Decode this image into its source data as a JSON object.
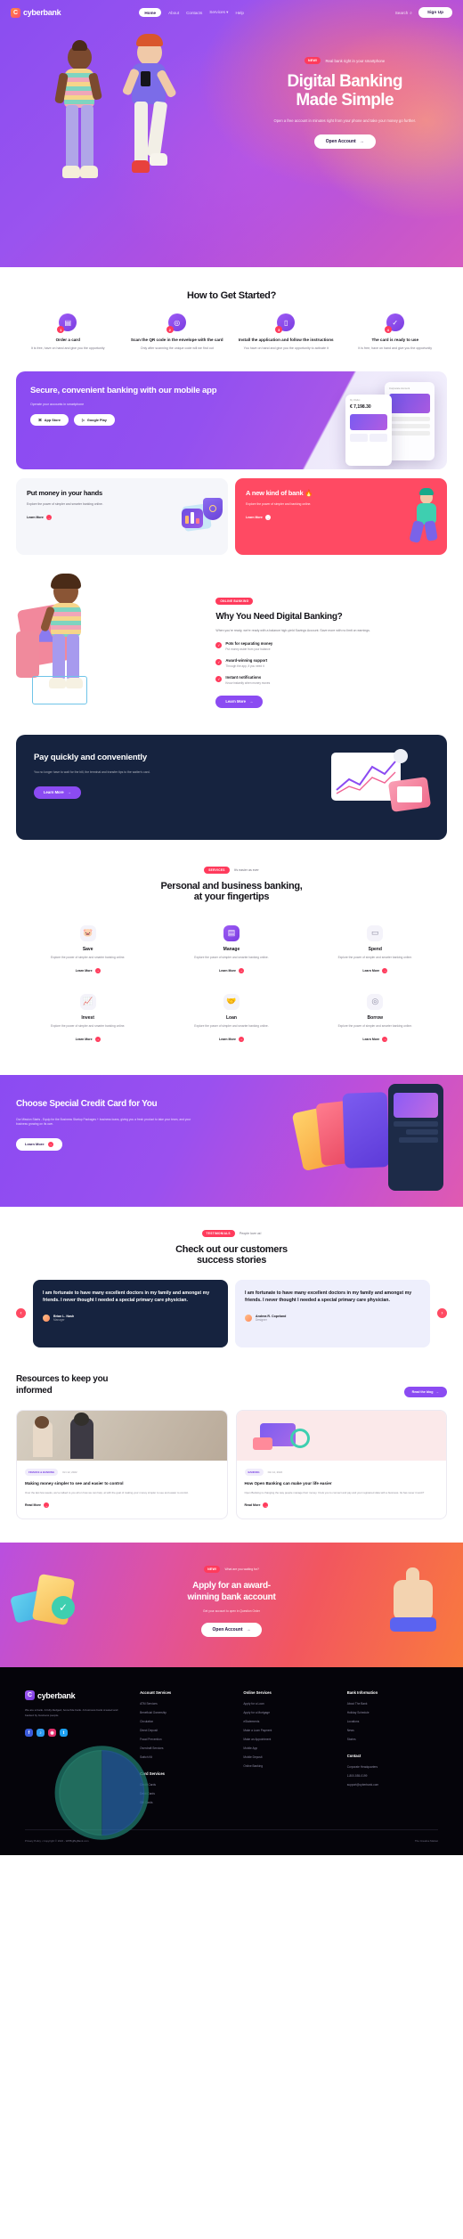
{
  "brand": {
    "name": "cyberbank",
    "mark": "C"
  },
  "nav": {
    "links": [
      {
        "label": "Home",
        "active": true
      },
      {
        "label": "About",
        "active": false
      },
      {
        "label": "Contacts",
        "active": false
      },
      {
        "label": "Services",
        "active": false
      },
      {
        "label": "Help",
        "active": false
      }
    ],
    "search_label": "Search",
    "search_icon": "search-icon",
    "signup_label": "Sign Up"
  },
  "hero": {
    "badge": "NEW!",
    "badge_text": "Real bank right in your smartphone",
    "title_line1": "Digital Banking",
    "title_line2": "Made Simple",
    "subtitle": "Open a free account in minutes right from your phone and take your money go further.",
    "cta_label": "Open Account",
    "cta_icon": "arrow-right-icon"
  },
  "steps_section": {
    "title": "How to Get Started?",
    "steps": [
      {
        "num": "1",
        "icon": "credit-card-icon",
        "title": "Order a card",
        "desc": "It is free, have on hand and give you the opportunity"
      },
      {
        "num": "2",
        "icon": "qr-scan-icon",
        "title": "Scan the QR code in the envelope with the card",
        "desc": "Only after scanning the unique code will we find out"
      },
      {
        "num": "3",
        "icon": "mobile-app-icon",
        "title": "Install the application and follow the instructions",
        "desc": "You have on hand and give you the opportunity to activate it"
      },
      {
        "num": "4",
        "icon": "check-circle-icon",
        "title": "The card is ready to use",
        "desc": "It is free, have on hand and give you the opportunity"
      }
    ]
  },
  "app_card": {
    "title": "Secure, convenient banking with our mobile app",
    "subtitle": "Operate your accounts in smartphone",
    "stores": [
      {
        "label": "App Store",
        "icon": "apple-icon"
      },
      {
        "label": "Google Play",
        "icon": "play-icon"
      }
    ],
    "mock_balance": "€ 7,198.30",
    "mock_label": "My Wallet",
    "mock_card_label": "Corporate Account"
  },
  "duo": [
    {
      "id": "put-money",
      "title": "Put money in your hands",
      "desc": "Explore the power of simpler and smarter banking online.",
      "learn_label": "Learn More",
      "theme": "light"
    },
    {
      "id": "new-bank",
      "title": "A new kind of bank 🔥",
      "desc": "Explore the power of simpler and banking online.",
      "learn_label": "Learn More",
      "theme": "red"
    }
  ],
  "why": {
    "tag": "ONLINE BANKING",
    "title": "Why You Need Digital Banking?",
    "lede": "When you're ready, we're ready with a balance high-yield Savings Account. Save more with no limit on earnings.",
    "features": [
      {
        "title": "Pots for separating money",
        "desc": "Put money aside from your balance"
      },
      {
        "title": "Award-winning support",
        "desc": "Through the app, if you need it"
      },
      {
        "title": "Instant notifications",
        "desc": "Know instantly when money moves"
      }
    ],
    "cta_label": "Learn More"
  },
  "pay_card": {
    "title": "Pay quickly and conveniently",
    "desc": "You no longer have to wait for the bill, the terminal and transfer tips to the waiter's card.",
    "cta_label": "Learn More"
  },
  "services": {
    "tag": "SERVICES",
    "tag_text": "It's easier as ever",
    "title_line1": "Personal and business banking,",
    "title_line2": "at your fingertips",
    "items": [
      {
        "icon": "piggy-bank-icon",
        "title": "Save",
        "desc": "Explore the power of simpler and smarter banking online.",
        "learn": "Learn More"
      },
      {
        "icon": "calculator-icon",
        "title": "Manage",
        "desc": "Explore the power of simpler and smarter banking online.",
        "learn": "Learn More"
      },
      {
        "icon": "wallet-icon",
        "title": "Spend",
        "desc": "Explore the power of simpler and smarter banking online.",
        "learn": "Learn More"
      },
      {
        "icon": "chart-up-icon",
        "title": "Invest",
        "desc": "Explore the power of simpler and smarter banking online.",
        "learn": "Learn More"
      },
      {
        "icon": "handshake-icon",
        "title": "Loan",
        "desc": "Explore the power of simpler and smarter banking online.",
        "learn": "Learn More"
      },
      {
        "icon": "coins-icon",
        "title": "Borrow",
        "desc": "Explore the power of simpler and smarter banking online.",
        "learn": "Learn More"
      }
    ]
  },
  "credit_card": {
    "title": "Choose Special Credit Card for You",
    "desc": "Our Mission Starts - Equip for the Business Startup Packages + business loans, giving you a fresh product to take your team, and your business growing on its own.",
    "cta_label": "Learn More"
  },
  "testimonials": {
    "tag": "TESTIMONIALS",
    "tag_text": "People love us!",
    "title_line1": "Check out our customers",
    "title_line2": "success stories",
    "prev_icon": "chevron-left-icon",
    "next_icon": "chevron-right-icon",
    "items": [
      {
        "quote": "I am fortunate to have many excellent doctors in my family and amongst my friends. I never thought I needed a special primary care physician.",
        "name": "Brian L. Nash",
        "role": "Manager",
        "theme": "dark"
      },
      {
        "quote": "I am fortunate to have many excellent doctors in my family and amongst my friends. I never thought I needed a special primary care physician.",
        "name": "Andrea R. Copeland",
        "role": "Designer",
        "theme": "light"
      }
    ]
  },
  "resources": {
    "title_line1": "Resources to keep you",
    "title_line2": "informed",
    "cta_label": "Read the blog",
    "posts": [
      {
        "category": "FINANCE & BANKING",
        "date": "Oct 12, 2022",
        "title": "Making money simpler to see and easier to control",
        "desc": "Over the last few weeks, we've talked to you all on how we can help, at with the goal of making your money simpler to see and easier to control.",
        "learn": "Read More"
      },
      {
        "category": "BANKING",
        "date": "Oct 12, 2022",
        "title": "How Open Banking can make your life easier",
        "desc": "Open Banking is changing the way people manage their money. It lets you to connect and pay and your registered data with a business. Its has never it work?",
        "learn": "Read More"
      }
    ]
  },
  "cta": {
    "tag": "NEW!",
    "tag_text": "What are you waiting for?",
    "title_line1": "Apply for an award-",
    "title_line2": "winning bank account",
    "desc": "Get your account to open in Question Order",
    "button_label": "Open Account",
    "button_icon": "arrow-right-icon"
  },
  "footer": {
    "about": "We are a bank. A fully-fledged, bona fide bank. A business bank created and backed by business people.",
    "socials": [
      {
        "icon": "facebook-icon",
        "color": "#3b5bdb"
      },
      {
        "icon": "tiktok-icon",
        "color": "#2f9bf0"
      },
      {
        "icon": "instagram-icon",
        "color": "#e1306c"
      },
      {
        "icon": "twitter-icon",
        "color": "#1da1f2"
      }
    ],
    "columns": [
      {
        "heading": "Account Services",
        "links": [
          "ATM Services",
          "Beneficial Ownership",
          "Circulation",
          "Direct Deposit",
          "Fraud Prevention",
          "Overdraft Services",
          "Switch Kit"
        ]
      },
      {
        "heading": "Online Services",
        "links": [
          "Apply for a Loan",
          "Apply for a Mortgage",
          "eStatements",
          "Make a Loan Payment",
          "Make an Appointment",
          "Mobile App",
          "Mobile Deposit",
          "Online Banking"
        ]
      },
      {
        "heading": "Bank Information",
        "links": [
          "About The Bank",
          "Holiday Schedule",
          "Locations",
          "News",
          "Stories"
        ]
      }
    ],
    "sub_columns": [
      {
        "heading": "Card Services",
        "links": [
          "Credit Cards",
          "Debit Cards",
          "Gift Cards"
        ]
      },
      {
        "heading": "Contact",
        "links": [
          "Corporate Headquarters",
          "1-800-555-0199",
          "support@cyberbank.com"
        ]
      }
    ],
    "copyright": "Privacy Policy • Copyright © 2022 - WPBigBigBank.com",
    "credit": "The Creative Market"
  }
}
